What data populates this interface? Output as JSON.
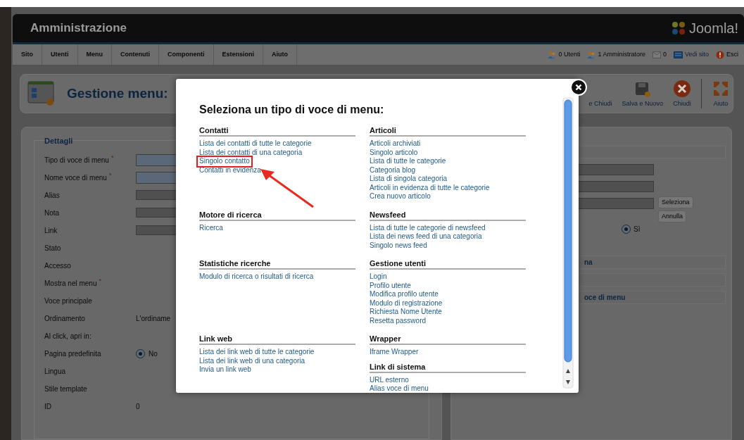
{
  "header": {
    "title": "Amministrazione",
    "logo_text": "Joomla!"
  },
  "menu_bar": {
    "items": [
      "Sito",
      "Utenti",
      "Menu",
      "Contenuti",
      "Componenti",
      "Estensioni",
      "Aiuto"
    ],
    "status": [
      {
        "kind": "users",
        "text": "0 Utenti"
      },
      {
        "kind": "admin",
        "text": "1 Amministratore"
      },
      {
        "kind": "messages",
        "text": "0"
      },
      {
        "kind": "site",
        "text": "Vedi sito"
      },
      {
        "kind": "logout",
        "text": "Esci"
      }
    ]
  },
  "toolbar": {
    "title": "Gestione menu:",
    "buttons": [
      {
        "kind": "save_close",
        "label": "e Chiudi"
      },
      {
        "kind": "save_new",
        "label": "Salva e Nuovo"
      },
      {
        "kind": "close",
        "label": "Chiudi"
      },
      {
        "kind": "help",
        "label": "Aiuto"
      }
    ]
  },
  "details": {
    "legend": "Dettagli",
    "required_mark": "*",
    "fields": [
      {
        "label": "Tipo di voce di menu",
        "required": true,
        "kind": "input",
        "highlighted": true
      },
      {
        "label": "Nome voce di menu",
        "required": true,
        "kind": "input",
        "highlighted": true
      },
      {
        "label": "Alias",
        "required": false,
        "kind": "input",
        "highlighted": false
      },
      {
        "label": "Nota",
        "required": false,
        "kind": "input",
        "highlighted": false
      },
      {
        "label": "Link",
        "required": false,
        "kind": "input",
        "highlighted": false
      },
      {
        "label": "Stato",
        "required": false,
        "kind": "none"
      },
      {
        "label": "Accesso",
        "required": false,
        "kind": "none"
      },
      {
        "label": "Mostra nel menu",
        "required": true,
        "kind": "none"
      },
      {
        "label": "Voce principale",
        "required": false,
        "kind": "none"
      },
      {
        "label": "Ordinamento",
        "required": false,
        "kind": "text",
        "value": "L'ordiname"
      },
      {
        "label": "Al click, apri in:",
        "required": false,
        "kind": "none"
      },
      {
        "label": "Pagina predefinita",
        "required": false,
        "kind": "radio",
        "value": "No",
        "selected": true
      },
      {
        "label": "Lingua",
        "required": false,
        "kind": "none"
      },
      {
        "label": "Stile template",
        "required": false,
        "kind": "none"
      },
      {
        "label": "ID",
        "required": false,
        "kind": "text",
        "value": "0"
      }
    ]
  },
  "side_panel": {
    "buttons": [
      "Seleziona",
      "Annulla"
    ],
    "radio": {
      "label": "Sì",
      "selected": true
    },
    "sections": [
      {
        "kind": "titled",
        "text": "na"
      },
      {
        "kind": "blank"
      },
      {
        "kind": "titled",
        "text": "oce di menu"
      }
    ]
  },
  "modal": {
    "title": "Seleziona un tipo di voce di menu:",
    "rows": [
      {
        "left": [
          {
            "heading": "Contatti",
            "items": [
              {
                "text": "Lista dei contatti di tutte le categorie",
                "highlighted": false
              },
              {
                "text": "Lista dei contatti di una categoria",
                "highlighted": false
              },
              {
                "text": "Singolo contatto",
                "highlighted": true
              },
              {
                "text": "Contatti in evidenza",
                "highlighted": false
              }
            ]
          }
        ],
        "right": [
          {
            "heading": "Articoli",
            "items": [
              {
                "text": "Articoli archiviati",
                "highlighted": false
              },
              {
                "text": "Singolo articolo",
                "highlighted": false
              },
              {
                "text": "Lista di tutte le categorie",
                "highlighted": false
              },
              {
                "text": "Categoria blog",
                "highlighted": false
              },
              {
                "text": "Lista di singola categoria",
                "highlighted": false
              },
              {
                "text": "Articoli in evidenza di tutte le categorie",
                "highlighted": false
              },
              {
                "text": "Crea nuovo articolo",
                "highlighted": false
              }
            ]
          }
        ]
      },
      {
        "left": [
          {
            "heading": "Motore di ricerca",
            "items": [
              {
                "text": "Ricerca",
                "highlighted": false
              }
            ]
          }
        ],
        "right": [
          {
            "heading": "Newsfeed",
            "items": [
              {
                "text": "Lista di tutte le categorie di newsfeed",
                "highlighted": false
              },
              {
                "text": "Lista dei news feed di una categoria",
                "highlighted": false
              },
              {
                "text": "Singolo news feed",
                "highlighted": false
              }
            ]
          }
        ]
      },
      {
        "left": [
          {
            "heading": "Statistiche ricerche",
            "items": [
              {
                "text": "Modulo di ricerca o risultati di ricerca",
                "highlighted": false
              }
            ]
          }
        ],
        "right": [
          {
            "heading": "Gestione utenti",
            "items": [
              {
                "text": "Login",
                "highlighted": false
              },
              {
                "text": "Profilo utente",
                "highlighted": false
              },
              {
                "text": "Modifica profilo utente",
                "highlighted": false
              },
              {
                "text": "Modulo di registrazione",
                "highlighted": false
              },
              {
                "text": "Richiesta Nome Utente",
                "highlighted": false
              },
              {
                "text": "Resetta password",
                "highlighted": false
              }
            ]
          }
        ]
      },
      {
        "left": [
          {
            "heading": "Link web",
            "items": [
              {
                "text": "Lista dei link web di tutte le categorie",
                "highlighted": false
              },
              {
                "text": "Lista dei link web di una categoria",
                "highlighted": false
              },
              {
                "text": "Invia un link web",
                "highlighted": false
              }
            ]
          }
        ],
        "right": [
          {
            "heading": "Wrapper",
            "items": [
              {
                "text": "Iframe Wrapper",
                "highlighted": false
              }
            ]
          },
          {
            "heading": "Link di sistema",
            "items": [
              {
                "text": "URL esterno",
                "highlighted": false
              },
              {
                "text": "Alias voce di menu",
                "highlighted": false
              }
            ]
          }
        ]
      }
    ]
  }
}
